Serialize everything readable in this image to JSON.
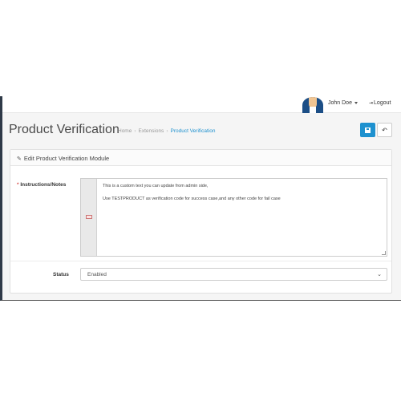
{
  "header": {
    "user_name": "John Doe",
    "logout_label": "Logout"
  },
  "page": {
    "title": "Product Verification",
    "breadcrumb": [
      "Home",
      "Extensions",
      "Product Verification"
    ]
  },
  "panel": {
    "heading": "Edit Product Verification Module"
  },
  "form": {
    "notes_label": "Instructions/Notes",
    "notes_required_mark": "*",
    "notes_lines": [
      "This is a custom text you can update from admin side,",
      "Use TESTPRODUCT as verification code for success case,and any other code for fail case"
    ],
    "status_label": "Status",
    "status_value": "Enabled"
  },
  "icons": {
    "user": "avatar",
    "logout": "sign-out-icon",
    "save": "save-icon",
    "back": "reply-icon",
    "edit": "pencil-icon",
    "select": "chevron-down-icon"
  },
  "colors": {
    "primary": "#1e91cf",
    "required": "#d9534f",
    "sidebar": "#2f3a48"
  }
}
